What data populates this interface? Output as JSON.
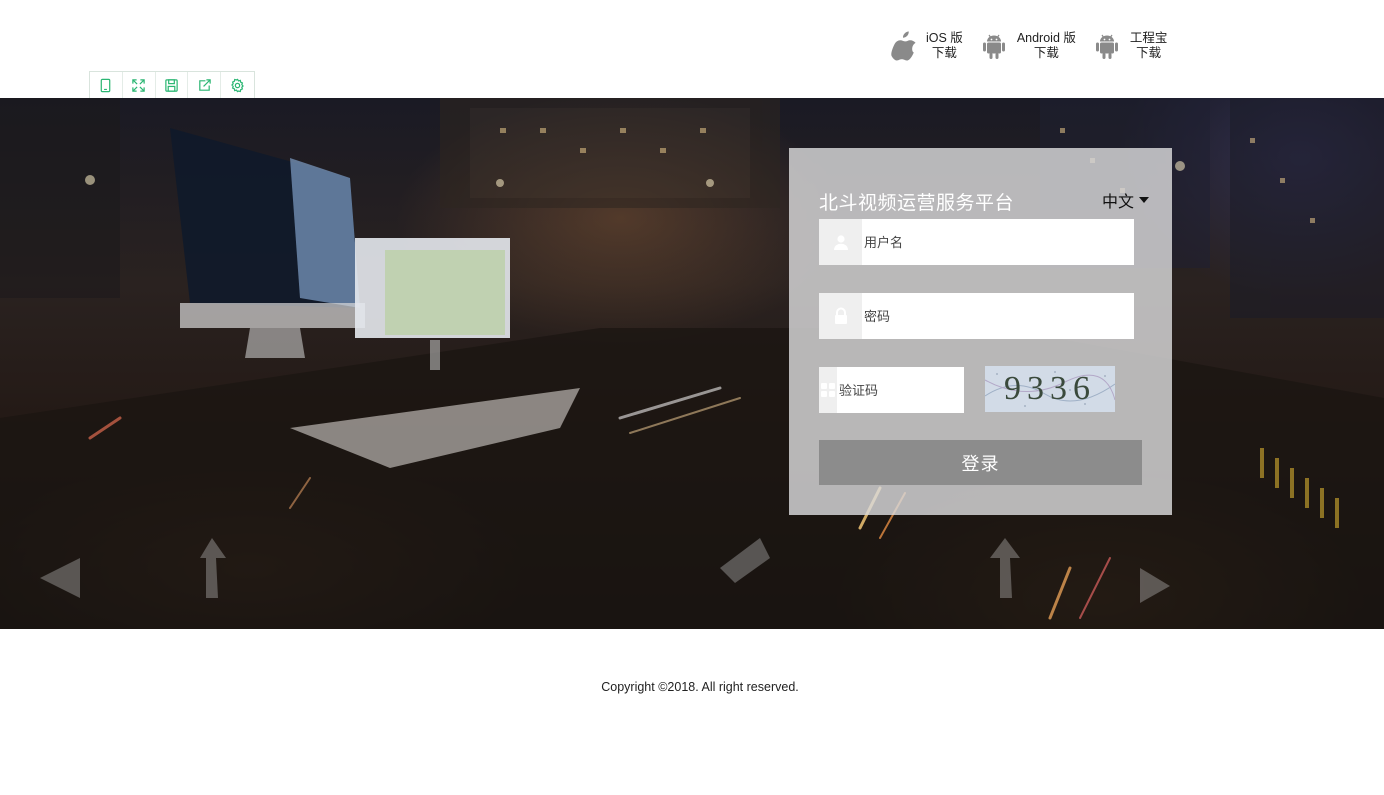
{
  "header": {
    "downloads": [
      {
        "icon": "apple-icon",
        "line1": "iOS 版",
        "line2": "下载"
      },
      {
        "icon": "android-icon",
        "line1": "Android 版",
        "line2": "下载"
      },
      {
        "icon": "android-icon",
        "line1": "工程宝",
        "line2": "下载"
      }
    ],
    "toolbar": {
      "icons": [
        "tablet-icon",
        "fullscreen-icon",
        "save-icon",
        "share-icon",
        "gear-icon"
      ],
      "accent_color": "#2bb673"
    }
  },
  "login": {
    "title": "北斗视频运营服务平台",
    "language": "中文",
    "username_placeholder": "用户名",
    "password_placeholder": "密码",
    "captcha_placeholder": "验证码",
    "captcha_text": "9336",
    "login_label": "登录",
    "button_color": "#8c8c8c"
  },
  "footer": {
    "copyright": "Copyright ©2018. All right reserved."
  }
}
